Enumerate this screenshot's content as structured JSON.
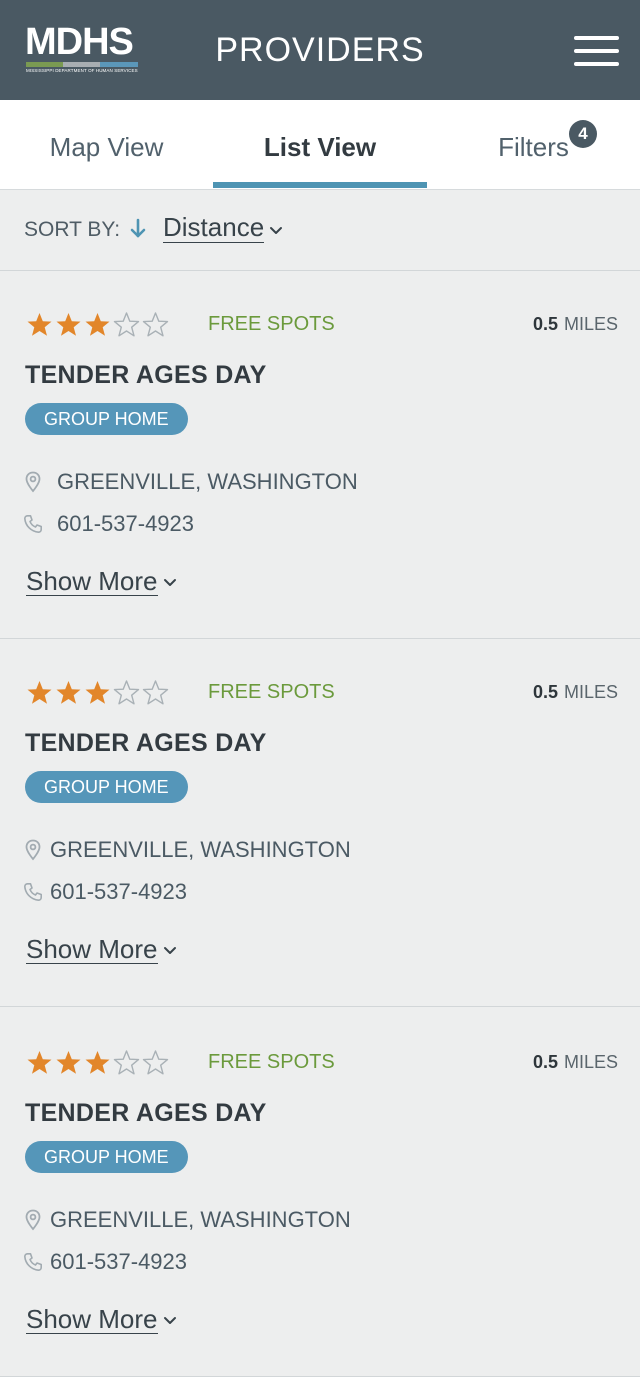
{
  "header": {
    "logo_text": "MDHS",
    "logo_subtitle": "MISSISSIPPI DEPARTMENT OF HUMAN SERVICES",
    "logo_bar_colors": [
      "#7a9a52",
      "#a8aeb2",
      "#5b97b9"
    ],
    "title": "PROVIDERS",
    "menu_icon": "hamburger-menu-icon"
  },
  "tabs": {
    "items": [
      {
        "label": "Map View",
        "active": false
      },
      {
        "label": "List View",
        "active": true
      },
      {
        "label": "Filters",
        "active": false
      }
    ],
    "filters_count": "4"
  },
  "sort": {
    "label": "SORT BY:",
    "value": "Distance",
    "direction_icon": "arrow-down-icon"
  },
  "colors": {
    "header_bg": "#4a5963",
    "accent": "#4e94b3",
    "star_filled": "#e2862a",
    "free_spots": "#6b9a3c",
    "badge": "#5596b9"
  },
  "providers": [
    {
      "rating": 3,
      "rating_max": 5,
      "availability": "FREE SPOTS",
      "distance_value": "0.5",
      "distance_unit": "MILES",
      "name": "TENDER AGES DAY",
      "type": "GROUP HOME",
      "location": "GREENVILLE, WASHINGTON",
      "phone": "601-537-4923",
      "show_more": "Show More"
    },
    {
      "rating": 3,
      "rating_max": 5,
      "availability": "FREE SPOTS",
      "distance_value": "0.5",
      "distance_unit": "MILES",
      "name": "TENDER AGES DAY",
      "type": "GROUP HOME",
      "location": "GREENVILLE, WASHINGTON",
      "phone": "601-537-4923",
      "show_more": "Show More"
    },
    {
      "rating": 3,
      "rating_max": 5,
      "availability": "FREE SPOTS",
      "distance_value": "0.5",
      "distance_unit": "MILES",
      "name": "TENDER AGES DAY",
      "type": "GROUP HOME",
      "location": "GREENVILLE, WASHINGTON",
      "phone": "601-537-4923",
      "show_more": "Show More"
    }
  ]
}
